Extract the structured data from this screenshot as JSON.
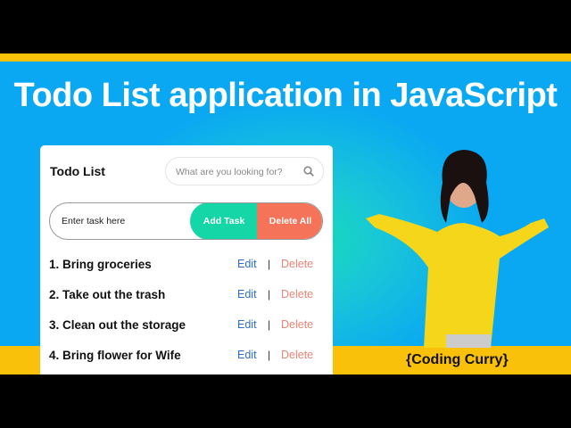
{
  "headline": "Todo List application in JavaScript",
  "brand": "{Coding Curry}",
  "app": {
    "title": "Todo List",
    "search_placeholder": "What are you looking for?",
    "task_placeholder": "Enter task here",
    "add_label": "Add Task",
    "delete_all_label": "Delete All",
    "edit_label": "Edit",
    "separator": "|",
    "delete_label": "Delete",
    "items": [
      "1. Bring groceries",
      "2. Take out the trash",
      "3. Clean out the storage",
      "4. Bring flower for Wife"
    ]
  },
  "colors": {
    "accent_green": "#14d6a6",
    "accent_red": "#f57459",
    "link_blue": "#2b6fce",
    "yellow": "#f9c10a",
    "sky": "#0aa8f2"
  }
}
